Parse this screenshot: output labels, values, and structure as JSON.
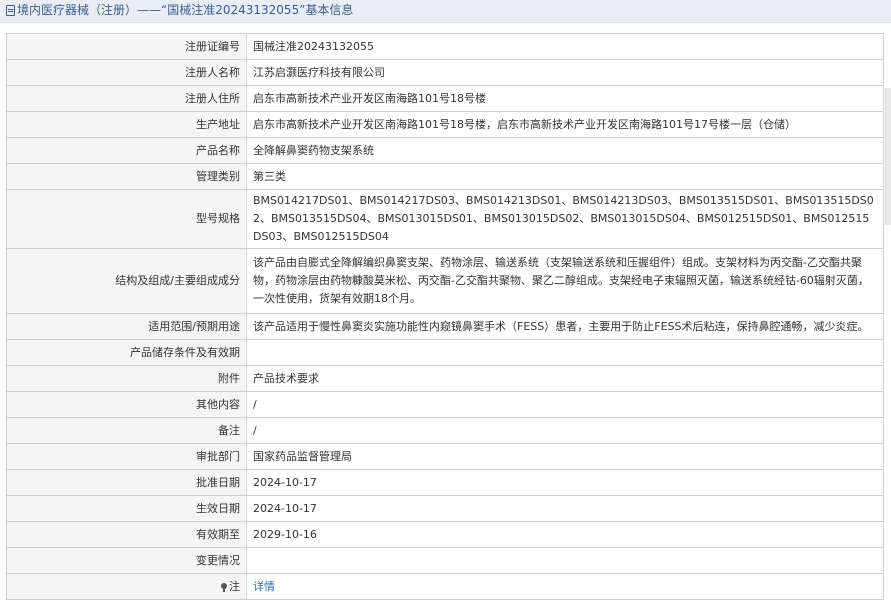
{
  "header": {
    "title": "境内医疗器械（注册）——“国械注准20243132055”基本信息"
  },
  "rows": [
    {
      "label": "注册证编号",
      "value": "国械注准20243132055"
    },
    {
      "label": "注册人名称",
      "value": "江苏启灏医疗科技有限公司"
    },
    {
      "label": "注册人住所",
      "value": "启东市高新技术产业开发区南海路101号18号楼"
    },
    {
      "label": "生产地址",
      "value": "启东市高新技术产业开发区南海路101号18号楼，启东市高新技术产业开发区南海路101号17号楼一层（仓储）"
    },
    {
      "label": "产品名称",
      "value": "全降解鼻窦药物支架系统"
    },
    {
      "label": "管理类别",
      "value": "第三类"
    },
    {
      "label": "型号规格",
      "value": "BMS014217DS01、BMS014217DS03、BMS014213DS01、BMS014213DS03、BMS013515DS01、BMS013515DS02、BMS013515DS04、BMS013015DS01、BMS013015DS02、BMS013015DS04、BMS012515DS01、BMS012515DS03、BMS012515DS04"
    },
    {
      "label": "结构及组成/主要组成成分",
      "value": "该产品由自膨式全降解编织鼻窦支架、药物涂层、输送系统（支架输送系统和压握组件）组成。支架材料为丙交酯-乙交酯共聚物，药物涂层由药物糠酸莫米松、丙交酯-乙交酯共聚物、聚乙二醇组成。支架经电子束辐照灭菌，输送系统经钴-60辐射灭菌，一次性使用，货架有效期18个月。"
    },
    {
      "label": "适用范围/预期用途",
      "value": "该产品适用于慢性鼻窦炎实施功能性内窥镜鼻窦手术（FESS）患者，主要用于防止FESS术后粘连，保持鼻腔通畅，减少炎症。"
    },
    {
      "label": "产品储存条件及有效期",
      "value": ""
    },
    {
      "label": "附件",
      "value": "产品技术要求"
    },
    {
      "label": "其他内容",
      "value": "/"
    },
    {
      "label": "备注",
      "value": "/"
    },
    {
      "label": "审批部门",
      "value": "国家药品监督管理局"
    },
    {
      "label": "批准日期",
      "value": "2024-10-17"
    },
    {
      "label": "生效日期",
      "value": "2024-10-17"
    },
    {
      "label": "有效期至",
      "value": "2029-10-16"
    },
    {
      "label": "变更情况",
      "value": ""
    }
  ],
  "note_row": {
    "label": "注",
    "link": "详情"
  },
  "icons": {
    "title": "document-icon",
    "note": "pin-icon"
  },
  "colors": {
    "title_bg": "#e9eef6",
    "title_text": "#3d5c8c",
    "label_bg": "#f5f5f5",
    "border": "#cfcfcf",
    "link": "#2a6ebb"
  }
}
